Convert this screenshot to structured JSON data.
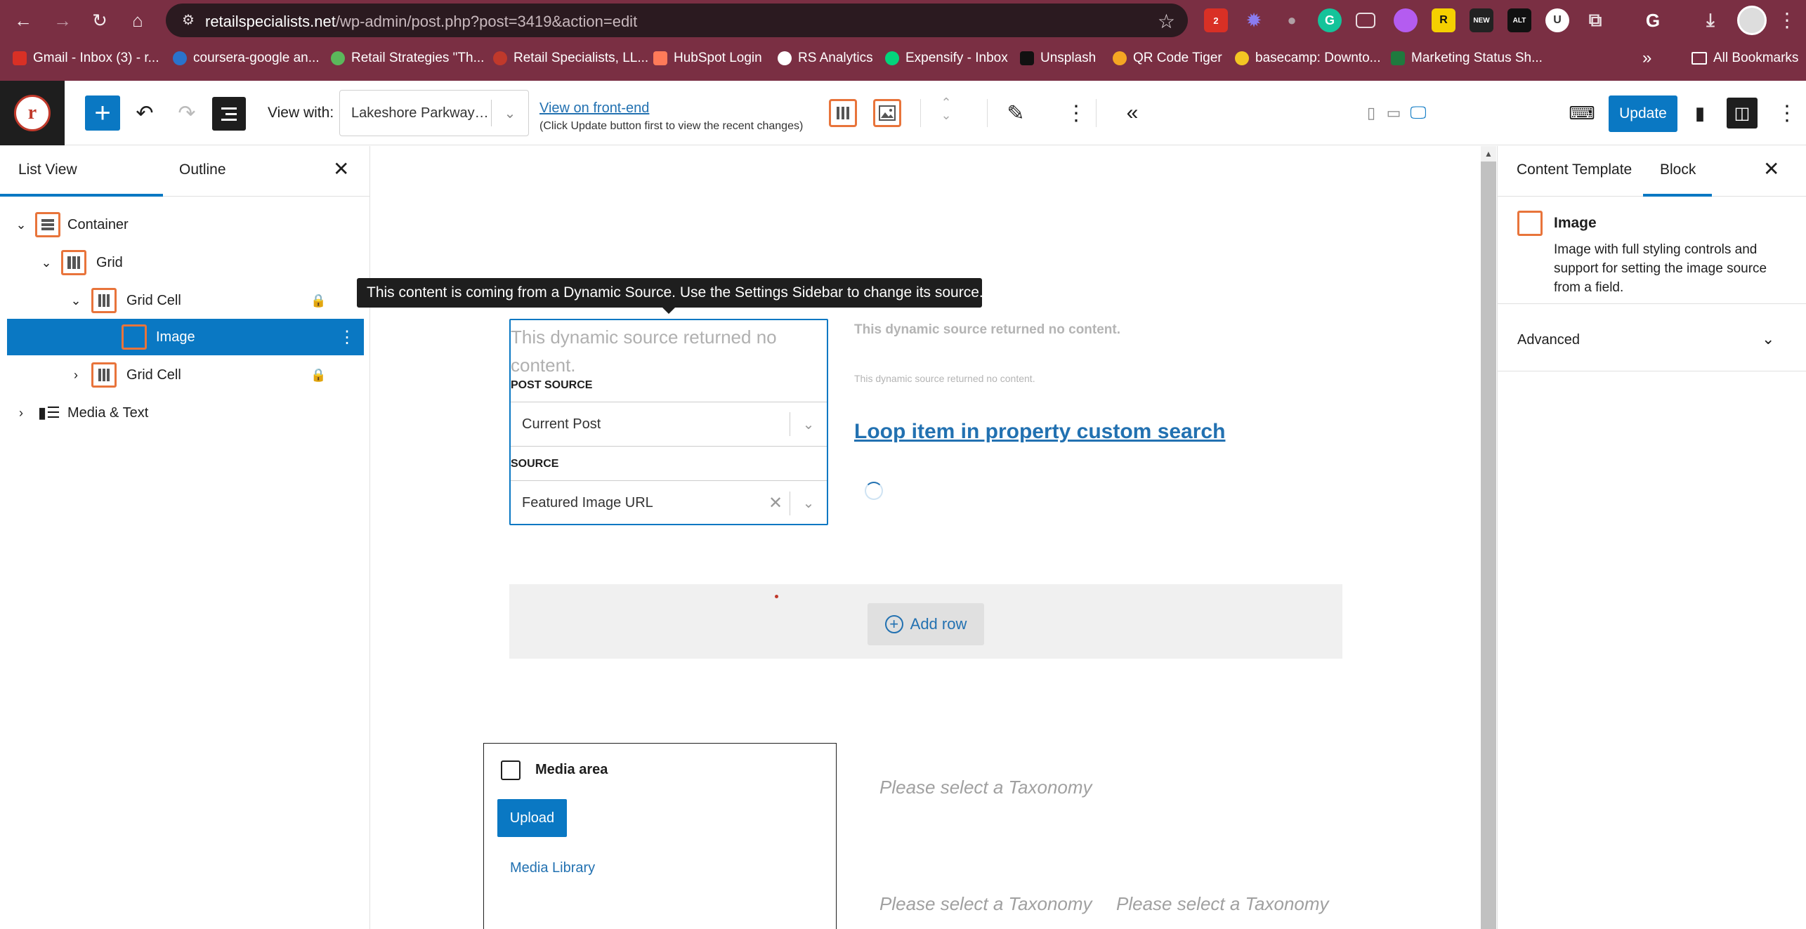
{
  "browser": {
    "url_host": "retailspecialists.net",
    "url_path": "/wp-admin/post.php?post=3419&action=edit",
    "extensions_badge": "2",
    "bookmarks": [
      {
        "label": "Gmail - Inbox (3) - r...",
        "color": "#d93025"
      },
      {
        "label": "coursera-google an...",
        "color": "#2a73cc"
      },
      {
        "label": "Retail Strategies \"Th...",
        "color": "#5bb85b"
      },
      {
        "label": "Retail Specialists, LL...",
        "color": "#c0392b"
      },
      {
        "label": "HubSpot Login",
        "color": "#ff7a59"
      },
      {
        "label": "RS Analytics",
        "color": "#ffffff"
      },
      {
        "label": "Expensify - Inbox",
        "color": "#03d47c"
      },
      {
        "label": "Unsplash",
        "color": "#111111"
      },
      {
        "label": "QR Code Tiger",
        "color": "#f5a623"
      },
      {
        "label": "basecamp: Downto...",
        "color": "#f3c623"
      },
      {
        "label": "Marketing Status Sh...",
        "color": "#1f7a3e"
      }
    ],
    "more_bookmarks": "»",
    "all_bookmarks": "All Bookmarks"
  },
  "toolbar": {
    "view_with_label": "View with:",
    "view_with_value": "Lakeshore Parkway O...",
    "front_end_link": "View on front-end",
    "front_end_note": "(Click Update button first to view the recent changes)",
    "update_label": "Update"
  },
  "left_panel": {
    "tabs": [
      "List View",
      "Outline"
    ],
    "tree": [
      {
        "label": "Container",
        "caret": "⌄",
        "depth": 0,
        "locked": false,
        "selected": false
      },
      {
        "label": "Grid",
        "caret": "⌄",
        "depth": 1,
        "locked": false,
        "selected": false
      },
      {
        "label": "Grid Cell",
        "caret": "⌄",
        "depth": 2,
        "locked": true,
        "selected": false
      },
      {
        "label": "Image",
        "caret": "",
        "depth": 3,
        "locked": false,
        "selected": true
      },
      {
        "label": "Grid Cell",
        "caret": "›",
        "depth": 2,
        "locked": true,
        "selected": false
      },
      {
        "label": "Media & Text",
        "caret": "›",
        "depth": 0,
        "locked": false,
        "selected": false
      }
    ]
  },
  "canvas": {
    "tooltip": "This content is coming from a Dynamic Source. Use the Settings Sidebar to change its source.",
    "dynamic_placeholder": "This dynamic source returned no content.",
    "post_source_label": "POST SOURCE",
    "post_source_value": "Current Post",
    "source_label": "SOURCE",
    "source_value": "Featured Image URL",
    "no_content_bold": "This dynamic source returned no content.",
    "no_content_small": "This dynamic source returned no content.",
    "loop_link": "Loop item in property custom search",
    "add_row": "Add row",
    "media_area_title": "Media area",
    "upload_label": "Upload",
    "media_library": "Media Library",
    "taxonomy_placeholder": "Please select a Taxonomy"
  },
  "right_panel": {
    "tabs": [
      "Content Template",
      "Block"
    ],
    "block_title": "Image",
    "block_desc": "Image with full styling controls and support for setting the image source from a field.",
    "advanced_label": "Advanced"
  },
  "colors": {
    "chrome": "#7a2f43",
    "wp_blue": "#0a78c3",
    "accent_orange": "#e8743b",
    "link": "#2271b1"
  }
}
